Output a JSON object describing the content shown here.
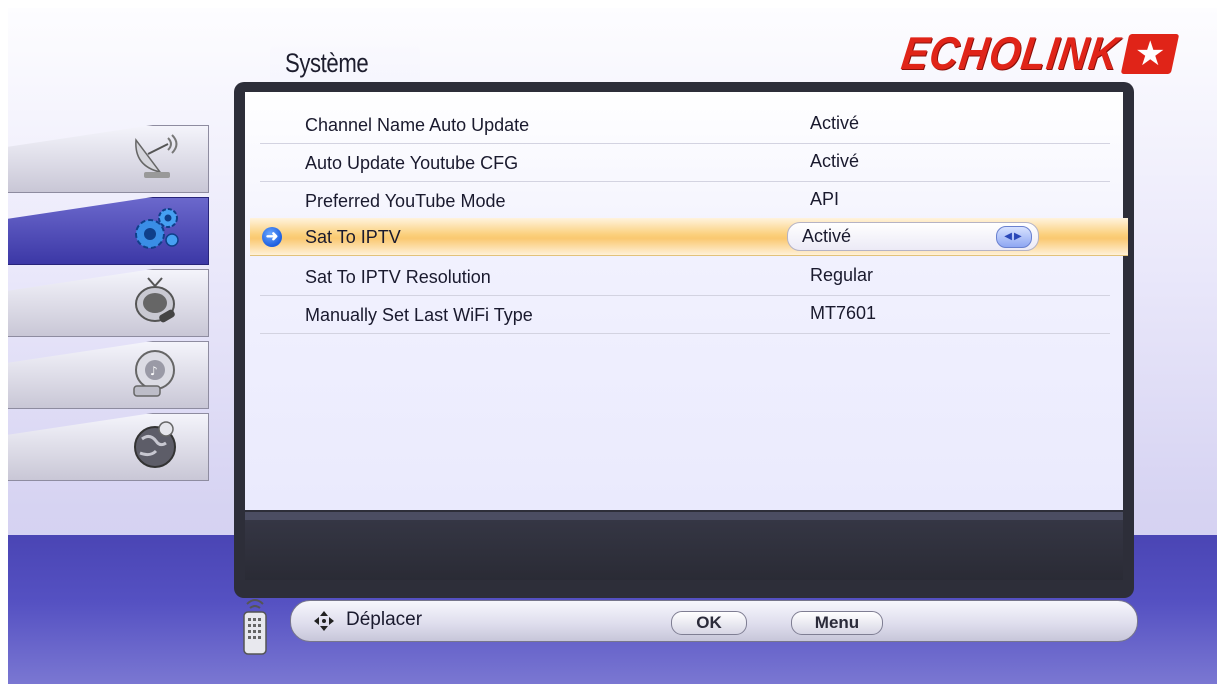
{
  "header": {
    "title": "Système",
    "brand": "ECHOLINK",
    "brand_icon": "red-star-box-logo"
  },
  "sidebar": {
    "items": [
      {
        "name": "satellite",
        "icon": "satellite-dish-icon",
        "active": false
      },
      {
        "name": "system",
        "icon": "gears-icon",
        "active": true
      },
      {
        "name": "tv",
        "icon": "tv-icon",
        "active": false
      },
      {
        "name": "media",
        "icon": "usb-media-icon",
        "active": false
      },
      {
        "name": "network",
        "icon": "globe-network-icon",
        "active": false
      }
    ]
  },
  "settings": {
    "rows": [
      {
        "label": "Channel Name Auto Update",
        "value": "Activé"
      },
      {
        "label": "Auto Update Youtube CFG",
        "value": "Activé"
      },
      {
        "label": "Preferred YouTube Mode",
        "value": "API"
      },
      {
        "label": "Sat To IPTV",
        "value": "Activé"
      },
      {
        "label": "Sat To IPTV Resolution",
        "value": "Regular"
      },
      {
        "label": "Manually Set Last WiFi Type",
        "value": "MT7601"
      }
    ],
    "selected_index": 3
  },
  "footer": {
    "move_label": "Déplacer",
    "ok_label": "OK",
    "menu_label": "Menu"
  },
  "colors": {
    "accent": "#3c38a6",
    "selection": "#fac870",
    "logo": "#e02418",
    "panel": "#2d2e39"
  }
}
